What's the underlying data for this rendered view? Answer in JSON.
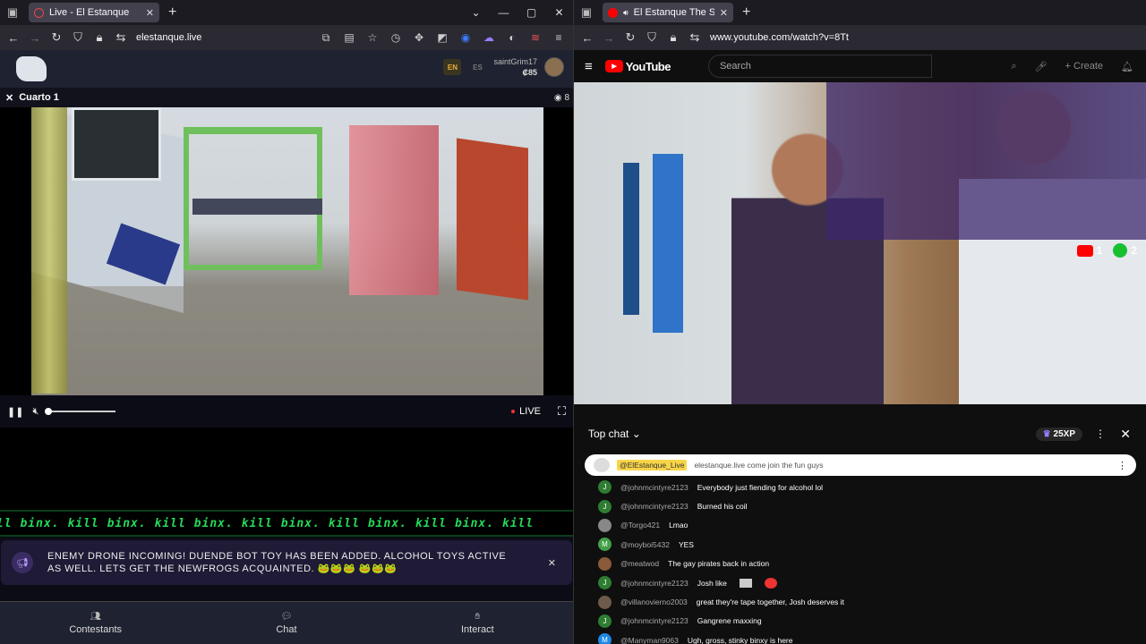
{
  "left_window": {
    "tab": {
      "title": "Live - El Estanque"
    },
    "url": "elestanque.live",
    "site": {
      "langs": [
        "EN",
        "ES"
      ],
      "username": "saintGrim17",
      "coins": "₡85",
      "camera_title": "Cuarto 1",
      "viewers": "8",
      "live_label": "LIVE",
      "ticker": "ll binx. kill binx. kill binx. kill binx. kill binx. kill binx. kill",
      "notice": "ENEMY DRONE INCOMING! DUENDE BOT TOY HAS BEEN ADDED. ALCOHOL TOYS ACTIVE AS WELL. LETS GET THE NEWFROGS ACQUAINTED. 🐸🐸🐸 🐸🐸🐸",
      "nav": [
        "Contestants",
        "Chat",
        "Interact"
      ]
    }
  },
  "right_window": {
    "tab": {
      "title": "El Estanque The Social Expe"
    },
    "url": "www.youtube.com/watch?v=8Tt",
    "youtube": {
      "logo": "YouTube",
      "search_placeholder": "Search",
      "create_label": "Create",
      "video_counts": {
        "yt": "1",
        "xbox": "2"
      },
      "chat": {
        "mode": "Top chat",
        "xp": "25XP",
        "pinned": {
          "author": "@ElEstanque_Live",
          "text": "elestanque.live come join the fun guys"
        },
        "messages": [
          {
            "initial": "J",
            "color": "#2e7d32",
            "author": "@johnmcintyre2123",
            "text": "Everybody just fiending for alcohol lol"
          },
          {
            "initial": "J",
            "color": "#2e7d32",
            "author": "@johnmcintyre2123",
            "text": "Burned his coil"
          },
          {
            "initial": "",
            "color": "#888888",
            "author": "@Torgo421",
            "text": "Lmao"
          },
          {
            "initial": "M",
            "color": "#43a047",
            "author": "@moyboi5432",
            "text": "YES"
          },
          {
            "initial": "",
            "color": "#8a5a3a",
            "author": "@meatwod",
            "text": "The gay pirates back in action"
          },
          {
            "initial": "J",
            "color": "#2e7d32",
            "author": "@johnmcintyre2123",
            "text": "Josh like"
          },
          {
            "initial": "",
            "color": "#6d5a4a",
            "author": "@villanovierno2003",
            "text": "great they're tape together, Josh deserves it"
          },
          {
            "initial": "J",
            "color": "#2e7d32",
            "author": "@johnmcintyre2123",
            "text": "Gangrene maxxing"
          },
          {
            "initial": "M",
            "color": "#1e88e5",
            "author": "@Manyman9063",
            "text": "Ugh, gross, stinky binxy is here"
          }
        ]
      }
    }
  },
  "window_controls": [
    "—",
    "▢",
    "✕"
  ]
}
